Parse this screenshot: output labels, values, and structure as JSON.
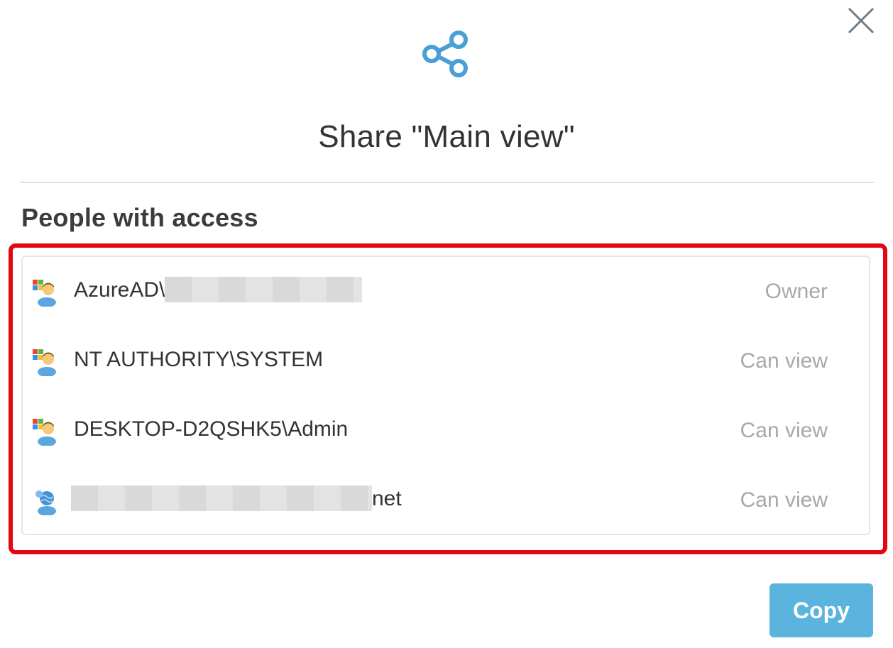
{
  "dialog": {
    "title": "Share \"Main view\"",
    "close_icon": "close-icon",
    "share_icon": "share-icon",
    "accent_color": "#4a9fd4",
    "highlight_color": "#e30613"
  },
  "access": {
    "section_title": "People with access",
    "users": [
      {
        "prefix": "AzureAD\\",
        "suffix": "",
        "redacted": true,
        "permission": "Owner",
        "icon": "windows-user-icon"
      },
      {
        "prefix": "NT AUTHORITY\\SYSTEM",
        "suffix": "",
        "redacted": false,
        "permission": "Can view",
        "icon": "windows-user-icon"
      },
      {
        "prefix": "DESKTOP-D2QSHK5\\Admin",
        "suffix": "",
        "redacted": false,
        "permission": "Can view",
        "icon": "windows-user-icon"
      },
      {
        "prefix": "",
        "suffix": "net",
        "redacted": true,
        "permission": "Can view",
        "icon": "globe-user-icon"
      }
    ]
  },
  "footer": {
    "copy_label": "Copy",
    "copy_color": "#5bb4dd"
  }
}
